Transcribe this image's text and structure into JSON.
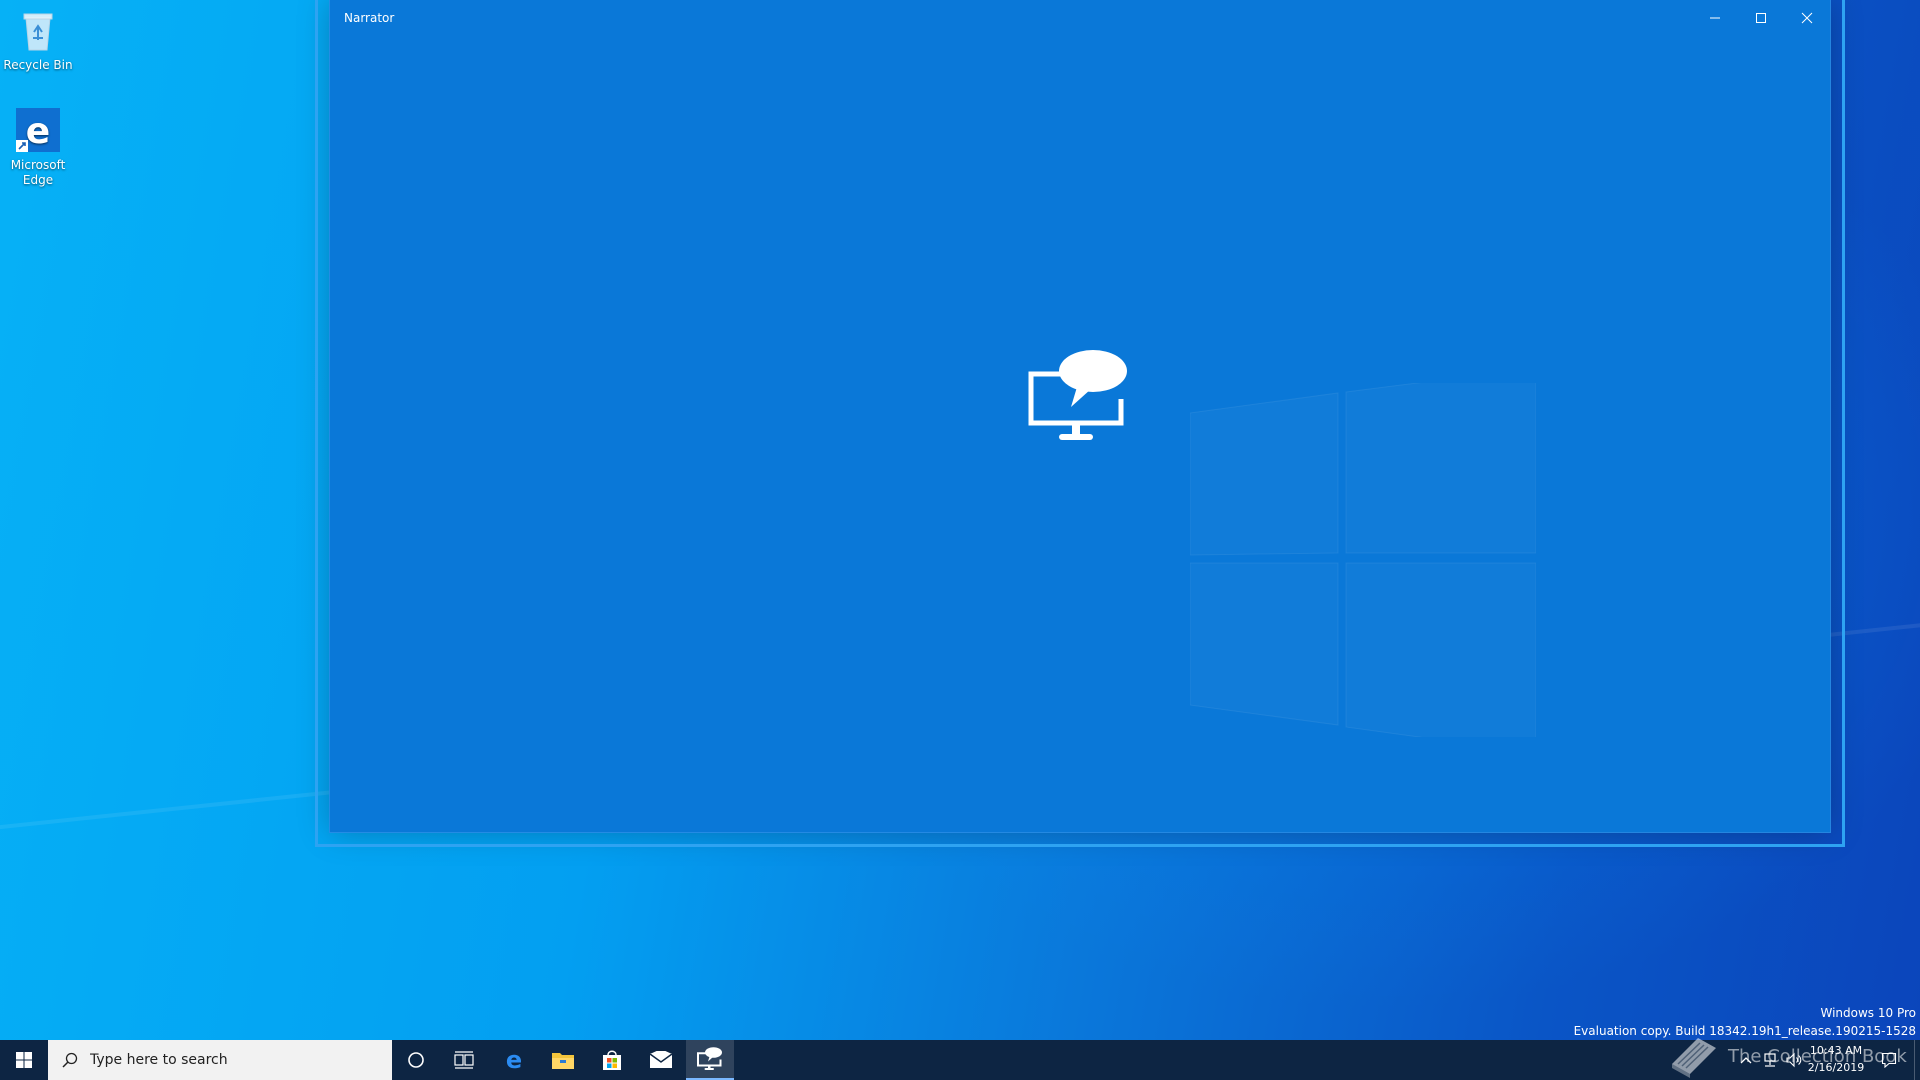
{
  "desktop": {
    "icons": [
      {
        "label": "Recycle Bin",
        "icon": "recycle-bin-icon"
      },
      {
        "label": "Microsoft Edge",
        "icon": "edge-icon"
      }
    ]
  },
  "window": {
    "title": "Narrator",
    "controls": [
      "minimize-icon",
      "maximize-icon",
      "close-icon"
    ],
    "hero_icon": "narrator-icon"
  },
  "watermark": {
    "line1": "Windows 10 Pro",
    "line2": "Evaluation copy. Build 18342.19h1_release.190215-1528"
  },
  "taskbar": {
    "search_placeholder": "Type here to search",
    "pinned": [
      "cortana-icon",
      "task-view-icon",
      "edge-icon",
      "file-explorer-icon",
      "store-icon",
      "mail-icon",
      "narrator-icon"
    ],
    "active_app": "narrator-icon",
    "tray_icons": [
      "chevron-up-icon",
      "network-icon",
      "volume-icon",
      "notifications-icon"
    ],
    "time": "10:43 AM",
    "date": "2/16/2019",
    "overlay_text": "The Collection Book"
  },
  "colors": {
    "window_bg": "#0a78d8",
    "taskbar_bg": "#0d2543",
    "accent": "#2ea3f2"
  }
}
